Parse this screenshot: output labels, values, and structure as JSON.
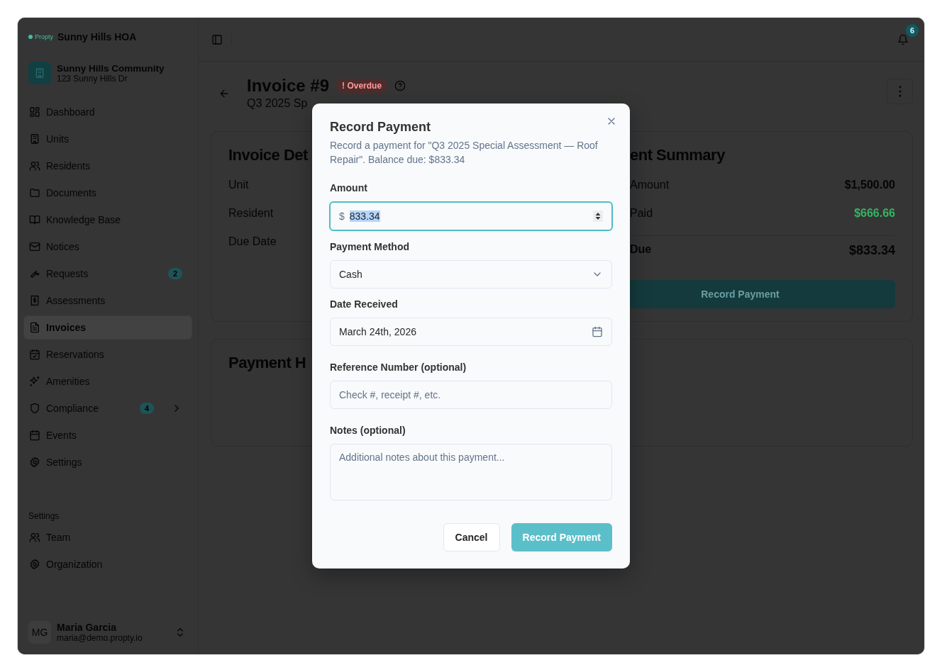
{
  "sidebar": {
    "logo_text": "Propty",
    "org_name": "Sunny Hills HOA",
    "community": {
      "name": "Sunny Hills Community",
      "address": "123 Sunny Hills Dr"
    },
    "nav_items": [
      {
        "label": "Dashboard",
        "selected": false
      },
      {
        "label": "Units",
        "selected": false
      },
      {
        "label": "Residents",
        "selected": false
      },
      {
        "label": "Documents",
        "selected": false
      },
      {
        "label": "Knowledge Base",
        "selected": false
      },
      {
        "label": "Notices",
        "selected": false
      },
      {
        "label": "Requests",
        "selected": false,
        "badge": "2"
      },
      {
        "label": "Assessments",
        "selected": false
      },
      {
        "label": "Invoices",
        "selected": true
      },
      {
        "label": "Reservations",
        "selected": false
      },
      {
        "label": "Amenities",
        "selected": false
      },
      {
        "label": "Compliance",
        "selected": false,
        "badge": "4",
        "expanded": false
      },
      {
        "label": "Events",
        "selected": false
      },
      {
        "label": "Settings",
        "selected": false
      }
    ],
    "settings_section": {
      "heading": "Settings",
      "items": [
        {
          "label": "Team",
          "selected": false
        },
        {
          "label": "Organization",
          "selected": false
        }
      ]
    },
    "user": {
      "initials": "MG",
      "name": "Maria Garcia",
      "email": "maria@demo.propty.io"
    }
  },
  "top_bar": {
    "notification_count": "6"
  },
  "page_header": {
    "title": "Invoice #9",
    "status": "! Overdue",
    "subtitle": "Q3 2025 Sp"
  },
  "invoice_details": {
    "title": "Invoice Det",
    "fields": [
      "Unit",
      "Resident",
      "Due Date"
    ]
  },
  "payment_summary": {
    "title": "ent Summary",
    "rows": [
      {
        "label": "Amount",
        "value": "$1,500.00",
        "kind": "plain"
      },
      {
        "label": "Paid",
        "value": "$666.66",
        "kind": "paid"
      },
      {
        "label": "Due",
        "value": "$833.34",
        "kind": "total"
      }
    ],
    "button": "Record Payment"
  },
  "payment_history": {
    "title": "Payment H"
  },
  "dialog": {
    "title": "Record Payment",
    "description": "Record a payment for \"Q3 2025 Special Assessment — Roof Repair\". Balance due: $833.34",
    "amount": {
      "label": "Amount",
      "prefix": "$",
      "value": "833.34",
      "text_selected": true,
      "focused": true
    },
    "payment_method": {
      "label": "Payment Method",
      "value": "Cash"
    },
    "date_received": {
      "label": "Date Received",
      "value": "March 24th, 2026"
    },
    "reference": {
      "label": "Reference Number (optional)",
      "placeholder": "Check #, receipt #, etc."
    },
    "notes": {
      "label": "Notes (optional)",
      "placeholder": "Additional notes about this payment..."
    },
    "buttons": {
      "cancel": "Cancel",
      "confirm": "Record Payment"
    }
  }
}
